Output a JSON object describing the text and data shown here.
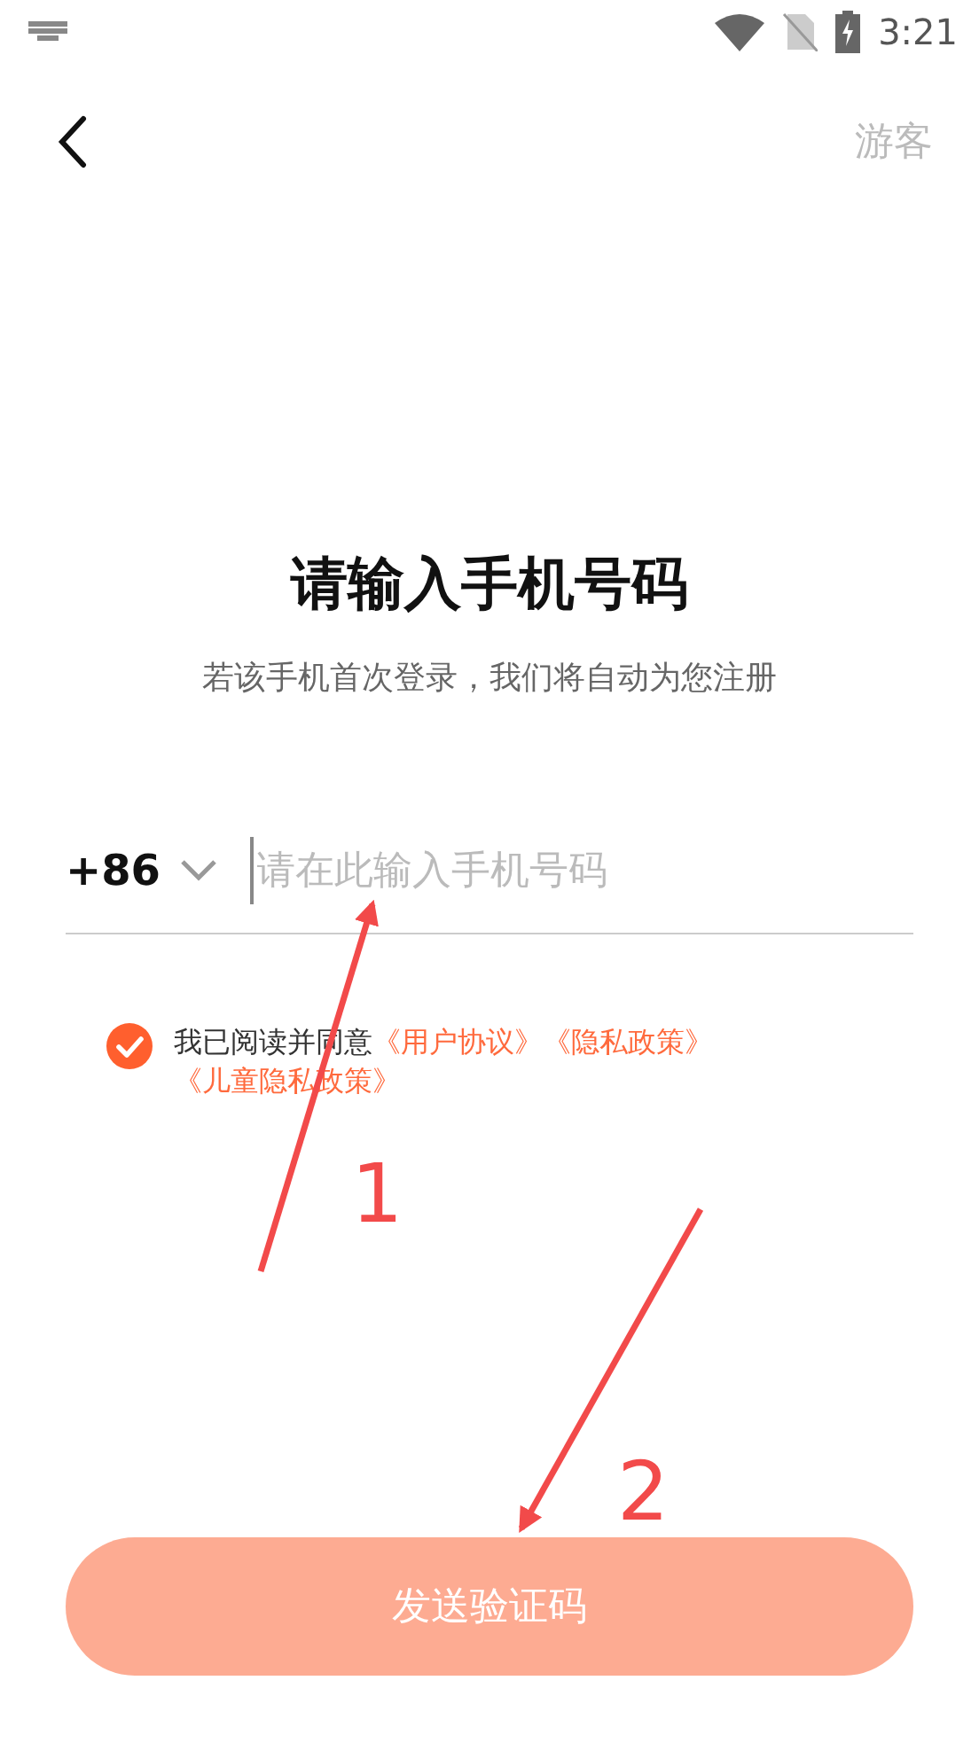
{
  "status_bar": {
    "time": "3:21"
  },
  "nav": {
    "guest_link": "游客"
  },
  "title": "请输入手机号码",
  "subtitle": "若该手机首次登录，我们将自动为您注册",
  "phone": {
    "country_code": "+86",
    "placeholder": "请在此输入手机号码"
  },
  "agreement": {
    "checked": true,
    "text": "我已阅读并同意",
    "links": [
      "《用户协议》",
      "《隐私政策》",
      "《儿童隐私政策》"
    ]
  },
  "submit_button": {
    "label": "发送验证码",
    "disabled": true
  },
  "annotations": [
    {
      "label": "1"
    },
    {
      "label": "2"
    }
  ]
}
